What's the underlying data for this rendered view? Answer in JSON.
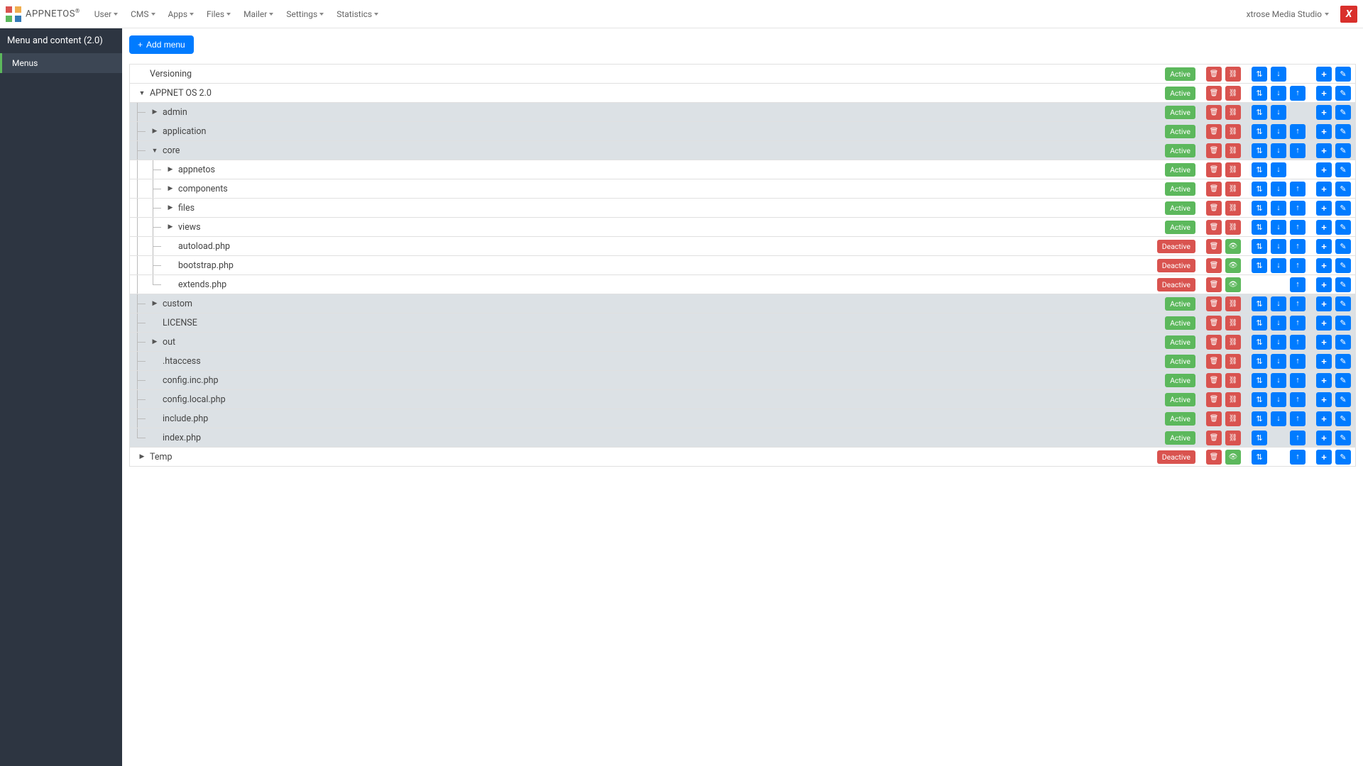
{
  "brand": {
    "name": "APPNETOS",
    "reg": "®"
  },
  "nav": [
    {
      "label": "User"
    },
    {
      "label": "CMS"
    },
    {
      "label": "Apps"
    },
    {
      "label": "Files"
    },
    {
      "label": "Mailer"
    },
    {
      "label": "Settings"
    },
    {
      "label": "Statistics"
    }
  ],
  "user": "xtrose Media Studio",
  "sidebar": {
    "title": "Menu and content (2.0)",
    "item": "Menus"
  },
  "addmenu": "Add menu",
  "status": {
    "active": "Active",
    "deactive": "Deactive"
  },
  "rows": [
    {
      "id": 0,
      "depth": 0,
      "toggle": "",
      "label": "Versioning",
      "shade": false,
      "status": "active",
      "red2": "link",
      "arrows": [
        "updown",
        "down"
      ],
      "pipes": []
    },
    {
      "id": 1,
      "depth": 0,
      "toggle": "down",
      "label": "APPNET OS 2.0",
      "shade": false,
      "status": "active",
      "red2": "link",
      "arrows": [
        "updown",
        "down",
        "up"
      ],
      "pipes": []
    },
    {
      "id": 2,
      "depth": 1,
      "toggle": "right",
      "label": "admin",
      "shade": true,
      "status": "active",
      "red2": "link",
      "arrows": [
        "updown",
        "down"
      ],
      "pipes": [
        "tee"
      ]
    },
    {
      "id": 3,
      "depth": 1,
      "toggle": "right",
      "label": "application",
      "shade": true,
      "status": "active",
      "red2": "link",
      "arrows": [
        "updown",
        "down",
        "up"
      ],
      "pipes": [
        "tee"
      ]
    },
    {
      "id": 4,
      "depth": 1,
      "toggle": "down",
      "label": "core",
      "shade": true,
      "status": "active",
      "red2": "link",
      "arrows": [
        "updown",
        "down",
        "up"
      ],
      "pipes": [
        "tee"
      ]
    },
    {
      "id": 5,
      "depth": 2,
      "toggle": "right",
      "label": "appnetos",
      "shade": false,
      "status": "active",
      "red2": "link",
      "arrows": [
        "updown",
        "down"
      ],
      "pipes": [
        "line",
        "tee"
      ]
    },
    {
      "id": 6,
      "depth": 2,
      "toggle": "right",
      "label": "components",
      "shade": false,
      "status": "active",
      "red2": "link",
      "arrows": [
        "updown",
        "down",
        "up"
      ],
      "pipes": [
        "line",
        "tee"
      ]
    },
    {
      "id": 7,
      "depth": 2,
      "toggle": "right",
      "label": "files",
      "shade": false,
      "status": "active",
      "red2": "link",
      "arrows": [
        "updown",
        "down",
        "up"
      ],
      "pipes": [
        "line",
        "tee"
      ]
    },
    {
      "id": 8,
      "depth": 2,
      "toggle": "right",
      "label": "views",
      "shade": false,
      "status": "active",
      "red2": "link",
      "arrows": [
        "updown",
        "down",
        "up"
      ],
      "pipes": [
        "line",
        "tee"
      ]
    },
    {
      "id": 9,
      "depth": 2,
      "toggle": "",
      "label": "autoload.php",
      "shade": false,
      "status": "deactive",
      "red2": "eye",
      "arrows": [
        "updown",
        "down",
        "up"
      ],
      "pipes": [
        "line",
        "tee"
      ]
    },
    {
      "id": 10,
      "depth": 2,
      "toggle": "",
      "label": "bootstrap.php",
      "shade": false,
      "status": "deactive",
      "red2": "eye",
      "arrows": [
        "updown",
        "down",
        "up"
      ],
      "pipes": [
        "line",
        "tee"
      ]
    },
    {
      "id": 11,
      "depth": 2,
      "toggle": "",
      "label": "extends.php",
      "shade": false,
      "status": "deactive",
      "red2": "eye",
      "arrows": [
        "up"
      ],
      "pipes": [
        "line",
        "teelast"
      ]
    },
    {
      "id": 12,
      "depth": 1,
      "toggle": "right",
      "label": "custom",
      "shade": true,
      "status": "active",
      "red2": "link",
      "arrows": [
        "updown",
        "down",
        "up"
      ],
      "pipes": [
        "tee"
      ]
    },
    {
      "id": 13,
      "depth": 1,
      "toggle": "",
      "label": "LICENSE",
      "shade": true,
      "status": "active",
      "red2": "link",
      "arrows": [
        "updown",
        "down",
        "up"
      ],
      "pipes": [
        "tee"
      ]
    },
    {
      "id": 14,
      "depth": 1,
      "toggle": "right",
      "label": "out",
      "shade": true,
      "status": "active",
      "red2": "link",
      "arrows": [
        "updown",
        "down",
        "up"
      ],
      "pipes": [
        "tee"
      ]
    },
    {
      "id": 15,
      "depth": 1,
      "toggle": "",
      "label": ".htaccess",
      "shade": true,
      "status": "active",
      "red2": "link",
      "arrows": [
        "updown",
        "down",
        "up"
      ],
      "pipes": [
        "tee"
      ]
    },
    {
      "id": 16,
      "depth": 1,
      "toggle": "",
      "label": "config.inc.php",
      "shade": true,
      "status": "active",
      "red2": "link",
      "arrows": [
        "updown",
        "down",
        "up"
      ],
      "pipes": [
        "tee"
      ]
    },
    {
      "id": 17,
      "depth": 1,
      "toggle": "",
      "label": "config.local.php",
      "shade": true,
      "status": "active",
      "red2": "link",
      "arrows": [
        "updown",
        "down",
        "up"
      ],
      "pipes": [
        "tee"
      ]
    },
    {
      "id": 18,
      "depth": 1,
      "toggle": "",
      "label": "include.php",
      "shade": true,
      "status": "active",
      "red2": "link",
      "arrows": [
        "updown",
        "down",
        "up"
      ],
      "pipes": [
        "tee"
      ]
    },
    {
      "id": 19,
      "depth": 1,
      "toggle": "",
      "label": "index.php",
      "shade": true,
      "status": "active",
      "red2": "link",
      "arrows": [
        "updown",
        "up"
      ],
      "pipes": [
        "teelast"
      ]
    },
    {
      "id": 20,
      "depth": 0,
      "toggle": "right",
      "label": "Temp",
      "shade": false,
      "status": "deactive",
      "red2": "eye",
      "arrows": [
        "updown",
        "up"
      ],
      "pipes": []
    }
  ]
}
